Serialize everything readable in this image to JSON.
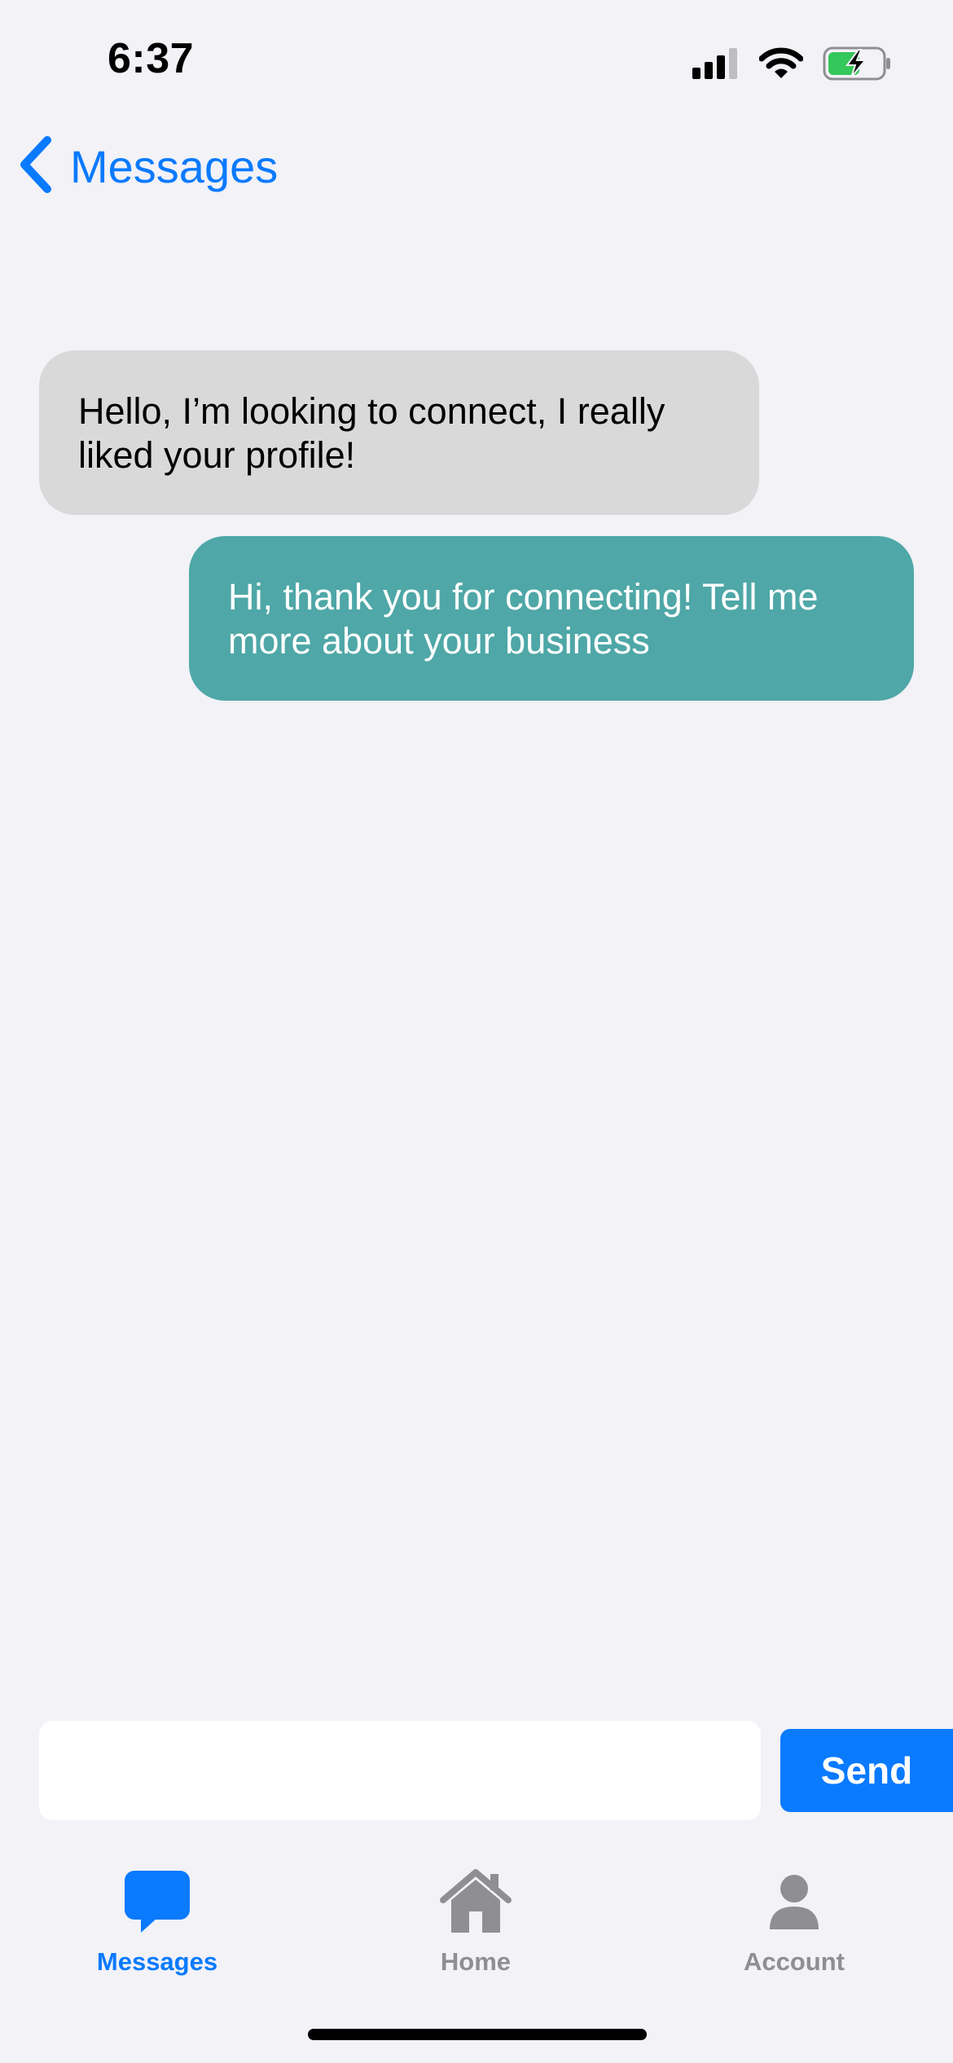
{
  "status_bar": {
    "time": "6:37",
    "icons": [
      "cellular-signal-icon",
      "wifi-icon",
      "battery-charging-icon"
    ],
    "battery_color": "#34c759"
  },
  "nav": {
    "back_label": "Messages",
    "back_icon": "chevron-left-icon",
    "accent_color": "#0a7aff"
  },
  "messages": [
    {
      "direction": "incoming",
      "text": "Hello, I’m looking to connect, I really liked your profile!",
      "bubble_color": "#d9d9d9"
    },
    {
      "direction": "outgoing",
      "text": "Hi, thank you for connecting! Tell me more about your business",
      "bubble_color": "#4fa7a7"
    }
  ],
  "composer": {
    "value": "",
    "placeholder": "",
    "send_label": "Send"
  },
  "tab_bar": {
    "items": [
      {
        "label": "Messages",
        "icon": "chat-bubble-icon",
        "active": true
      },
      {
        "label": "Home",
        "icon": "house-icon",
        "active": false
      },
      {
        "label": "Account",
        "icon": "person-icon",
        "active": false
      }
    ],
    "active_color": "#0a7aff",
    "inactive_color": "#8e8e93"
  }
}
